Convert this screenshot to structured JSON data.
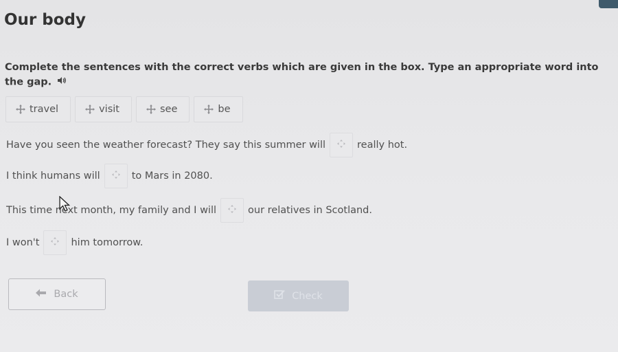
{
  "page": {
    "title": "Our body"
  },
  "instructions": {
    "text": "Complete the sentences with the correct verbs which are given in the box. Type an appropriate word into the gap.",
    "audio_icon": "speaker-icon"
  },
  "word_bank": {
    "icon": "move-icon",
    "words": [
      "travel",
      "visit",
      "see",
      "be"
    ]
  },
  "sentences": [
    {
      "before": "Have you seen the weather forecast? They say this summer will",
      "answer": "",
      "after": "really hot."
    },
    {
      "before": "I think humans will",
      "answer": "",
      "after": "to Mars in 2080."
    },
    {
      "before": "This time next month, my family and I will",
      "answer": "",
      "after": "our relatives in Scotland."
    },
    {
      "before": "I won't",
      "answer": "",
      "after": "him tomorrow."
    }
  ],
  "buttons": {
    "back_label": "Back",
    "back_icon": "arrow-left-icon",
    "check_label": "Check",
    "check_icon": "check-square-icon"
  },
  "colors": {
    "accent": "#3f5a6b",
    "check_disabled_bg": "#c9cdd5"
  }
}
